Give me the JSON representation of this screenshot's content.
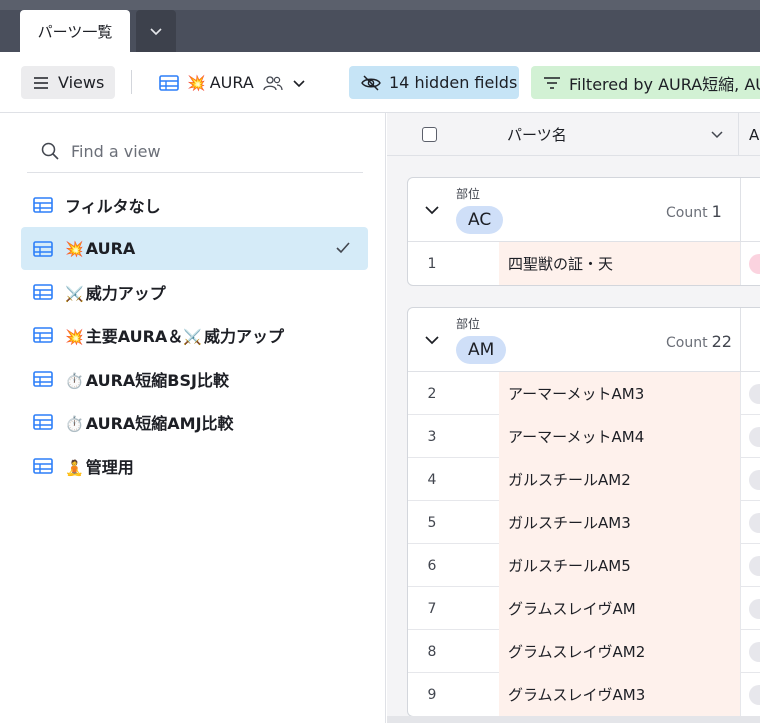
{
  "tabbar": {
    "active_tab": "パーツ一覧"
  },
  "viewbar": {
    "views_label": "Views",
    "current_view": "AURA",
    "current_view_emoji": "💥",
    "hidden_fields_label": "14 hidden fields",
    "filter_label": "Filtered by AURA短縮, AU"
  },
  "sidebar": {
    "search_placeholder": "Find a view",
    "items": [
      {
        "emoji": "",
        "label": "フィルタなし",
        "active": false
      },
      {
        "emoji": "💥",
        "label": "AURA",
        "active": true
      },
      {
        "emoji": "⚔️",
        "label": "威力アップ",
        "active": false
      },
      {
        "emoji": "💥",
        "label": "主要AURA＆",
        "emoji2": "⚔️",
        "label2": "威力アップ",
        "active": false
      },
      {
        "emoji": "⏱️",
        "label": "AURA短縮BSJ比較",
        "active": false
      },
      {
        "emoji": "⏱️",
        "label": "AURA短縮AMJ比較",
        "active": false
      },
      {
        "emoji": "🧘",
        "label": "管理用",
        "active": false
      }
    ]
  },
  "grid": {
    "name_column_header": "パーツ名",
    "next_column_header_partial": "A",
    "groups": [
      {
        "field_label": "部位",
        "value": "AC",
        "count_label": "Count",
        "count": "1",
        "rows": [
          {
            "num": "1",
            "name": "四聖獣の証・天"
          }
        ]
      },
      {
        "field_label": "部位",
        "value": "AM",
        "count_label": "Count",
        "count": "22",
        "rows": [
          {
            "num": "2",
            "name": "アーマーメットAM3"
          },
          {
            "num": "3",
            "name": "アーマーメットAM4"
          },
          {
            "num": "4",
            "name": "ガルスチールAM2"
          },
          {
            "num": "5",
            "name": "ガルスチールAM3"
          },
          {
            "num": "6",
            "name": "ガルスチールAM5"
          },
          {
            "num": "7",
            "name": "グラムスレイヴAM"
          },
          {
            "num": "8",
            "name": "グラムスレイヴAM2"
          },
          {
            "num": "9",
            "name": "グラムスレイヴAM3"
          }
        ]
      }
    ]
  },
  "colors": {
    "tabbar_bg": "#4a4f5c",
    "hidden_fields_bg": "#c6e4f6",
    "filter_bg": "#d2f1d4",
    "active_view_bg": "#d5ebf8",
    "group_pill_bg": "#cfdff8",
    "primary_cell_bg": "#fef1ec",
    "view_icon": "#2d7ff9"
  },
  "icons": {
    "views_button": "hamburger-icon",
    "grid_view": "grid-view-icon",
    "collaborative": "people-icon",
    "hidden_fields": "eye-slash-icon",
    "filter": "filter-lines-icon",
    "search": "search-icon",
    "check": "check-icon",
    "group_toggle": "chevron-down-icon"
  }
}
